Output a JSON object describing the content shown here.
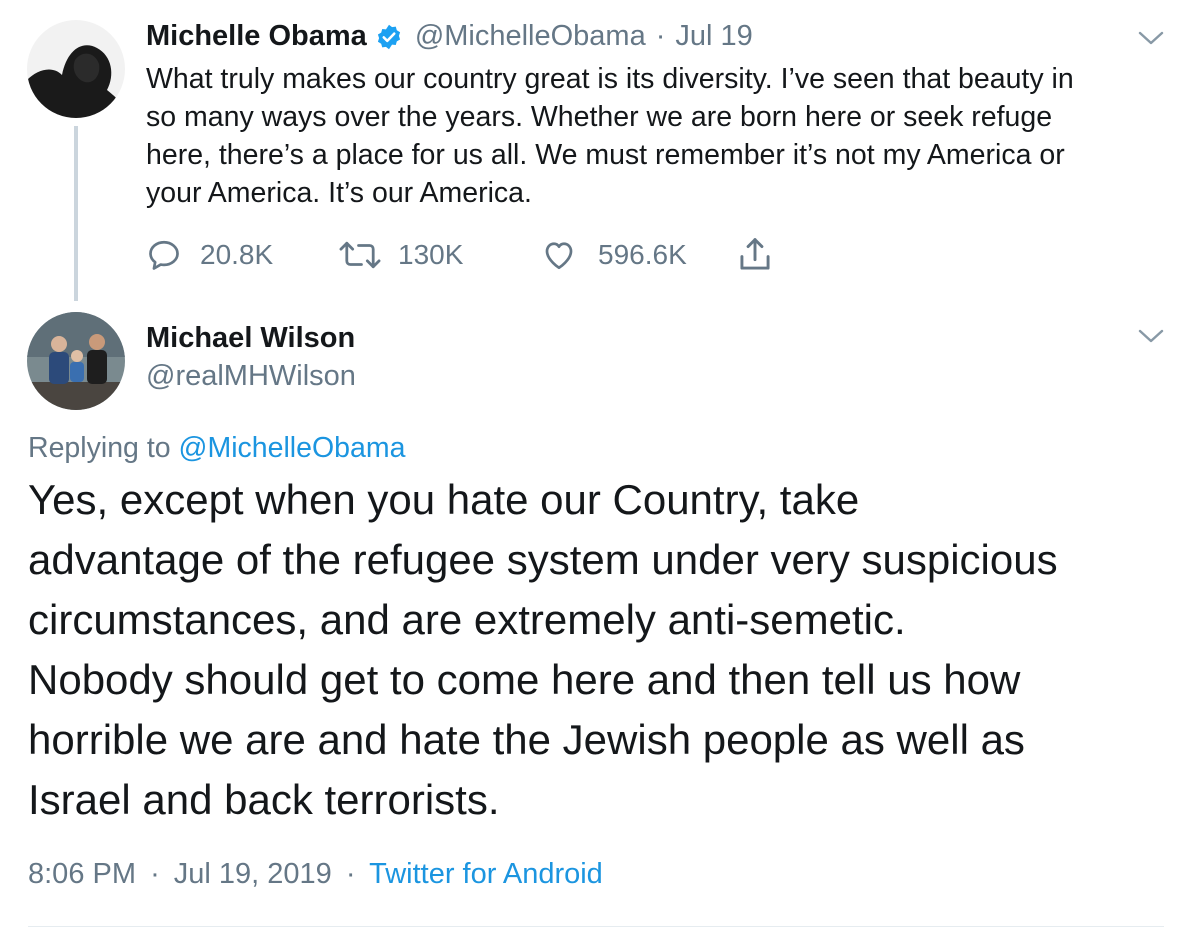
{
  "tweet1": {
    "author_name": "Michelle Obama",
    "verified": true,
    "handle": "@MichelleObama",
    "separator": "·",
    "date": "Jul 19",
    "text_lines": [
      "What truly makes our country great is its diversity. I’ve seen that beauty in",
      "so many ways over the years. Whether we are born here or seek refuge",
      "here, there’s a place for us all. We must remember it’s not my America or",
      "your America. It’s our America."
    ],
    "actions": {
      "reply_count": "20.8K",
      "retweet_count": "130K",
      "like_count": "596.6K"
    }
  },
  "tweet2": {
    "author_name": "Michael Wilson",
    "handle": "@realMHWilson",
    "replying_prefix": "Replying to",
    "replying_to": "@MichelleObama",
    "text_lines": [
      "Yes, except when you hate our Country, take",
      "advantage of the refugee system under very suspicious",
      "circumstances, and are extremely anti-semetic.",
      "Nobody should get to come here and then tell us how",
      "horrible we are and hate the Jewish people as well as",
      "Israel and back terrorists."
    ],
    "time": "8:06 PM",
    "separator": "·",
    "date": "Jul 19, 2019",
    "separator2": "·",
    "source": "Twitter for Android"
  },
  "colors": {
    "text": "#14171a",
    "secondary": "#657786",
    "link": "#1b95e0",
    "verified": "#1da1f2",
    "thread_line": "#cbd5dd"
  },
  "icons": [
    "chevron-down-icon",
    "verified-badge-icon",
    "reply-icon",
    "retweet-icon",
    "like-icon",
    "share-icon"
  ]
}
